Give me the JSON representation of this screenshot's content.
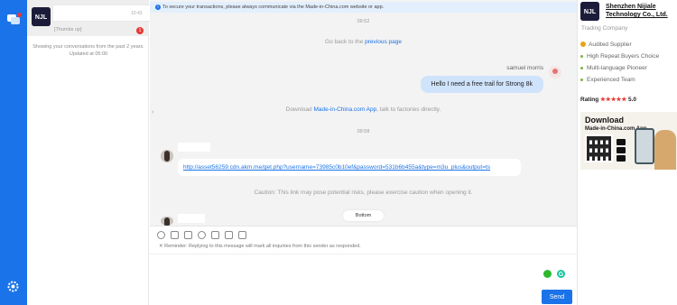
{
  "rail": {
    "settings": "settings"
  },
  "conversations": {
    "items": [
      {
        "time": "10:43",
        "preview": "[Thumbs up]",
        "unread": "1",
        "logo_text": "NJL"
      }
    ],
    "note": "Showing your conversations from the past 2 years. Updated at 05:00"
  },
  "chat": {
    "banner": "To secure your transactions, please always communicate via the Made-in-China.com website or app.",
    "time1": "09:52",
    "go_back_prefix": "Go back to the ",
    "go_back_link": "previous page",
    "sender_name": "samuel morris",
    "my_message": "Hello I need a free trail for Strong 8k",
    "download_prefix": "Download ",
    "download_link": "Made-in-China.com App",
    "download_suffix": ", talk to factories directly.",
    "time2": "09:58",
    "their_link": "http://asset56259.cdn.akm.me/get.php?username=73985c0b10ef&password=531b6b455a&type=m3u_plus&output=ts",
    "caution": "Caution: This link may pose potential risks, please exercise caution when opening it.",
    "bottom_button": "Bottom"
  },
  "composer": {
    "reminder": "Reminder: Replying to this message will mark all inquiries from this sender as responded.",
    "send_label": "Send",
    "grammarly": "G"
  },
  "supplier": {
    "logo_text": "NJL",
    "company": "Shenzhen Nijiale Technology Co., Ltd.",
    "type": "Trading Company",
    "audited": "Audited Supplier",
    "features": [
      "High Repeat Buyers Choice",
      "Multi-language Pioneer",
      "Experienced Team"
    ],
    "rating_label": "Rating",
    "stars": "★★★★★",
    "rating_value": "5.0",
    "download_title": "Download",
    "download_sub": "Made-in-China.com App"
  },
  "colors": {
    "accent": "#1a73e8",
    "badge": "#e53935",
    "star": "#e53935",
    "bubble_me": "#cfe3fb"
  }
}
